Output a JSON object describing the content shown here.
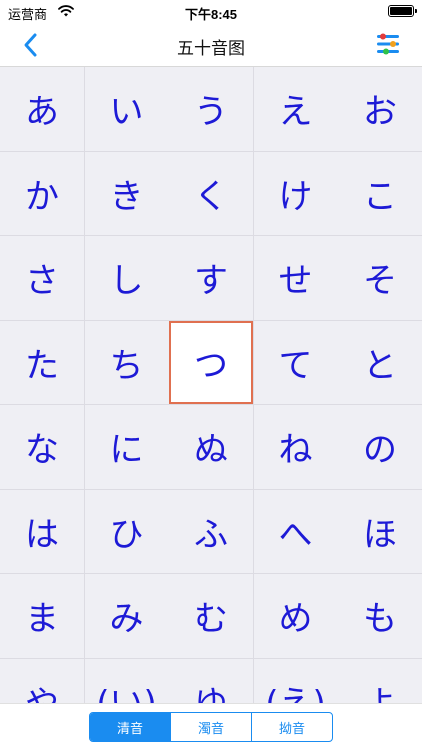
{
  "status": {
    "carrier": "运营商",
    "time": "下午8:45",
    "battery_level": 1.0
  },
  "nav": {
    "title": "五十音图",
    "back_icon": "chevron-left-icon",
    "settings_icon": "sliders-icon",
    "accent": "#1a8cf0"
  },
  "grid": {
    "kana_color": "#1d1ad6",
    "selected_border": "#e07050",
    "selected_index": 17,
    "cells": [
      "あ",
      "い",
      "う",
      "え",
      "お",
      "か",
      "き",
      "く",
      "け",
      "こ",
      "さ",
      "し",
      "す",
      "せ",
      "そ",
      "た",
      "ち",
      "つ",
      "て",
      "と",
      "な",
      "に",
      "ぬ",
      "ね",
      "の",
      "は",
      "ひ",
      "ふ",
      "へ",
      "ほ",
      "ま",
      "み",
      "む",
      "め",
      "も",
      "や",
      "(い)",
      "ゆ",
      "(え)",
      "よ"
    ]
  },
  "tabs": [
    {
      "label": "清音",
      "active": true
    },
    {
      "label": "濁音",
      "active": false
    },
    {
      "label": "拗音",
      "active": false
    }
  ]
}
